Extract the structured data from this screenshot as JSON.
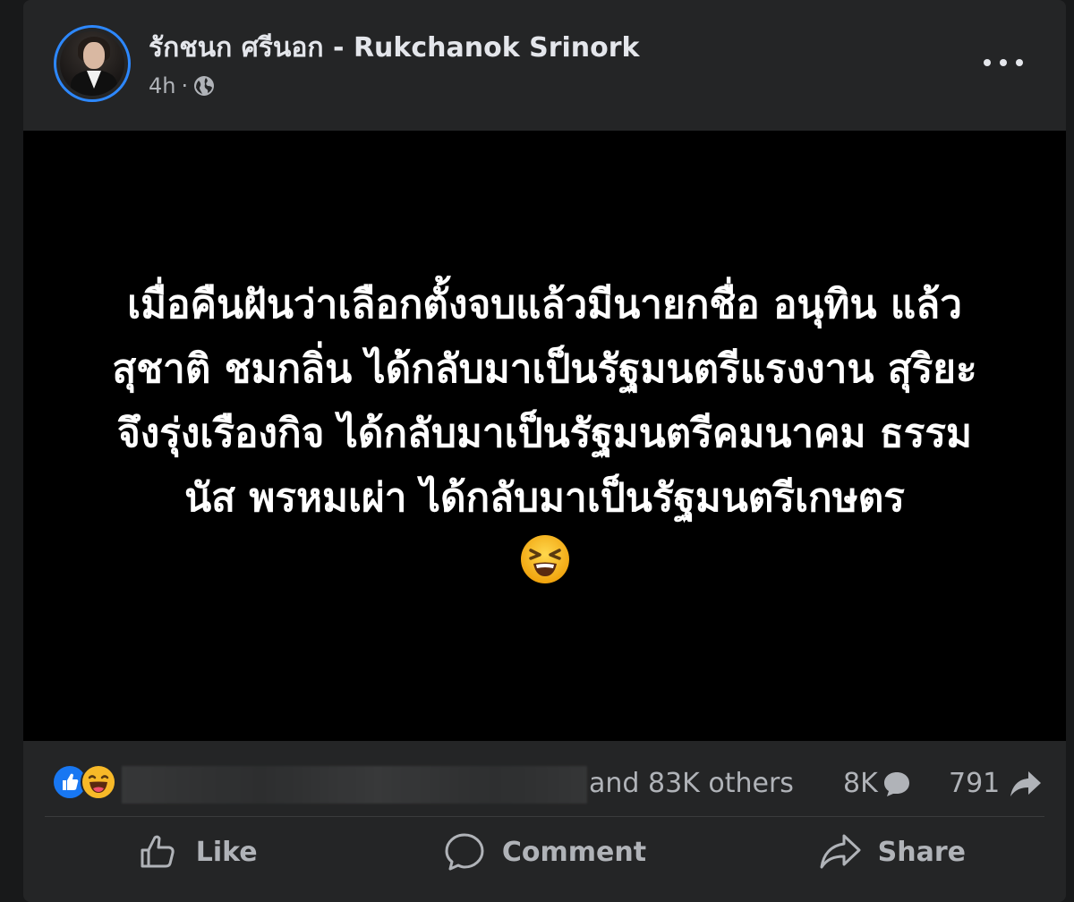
{
  "post": {
    "author": "รักชนก ศรีนอก - Rukchanok Srinork",
    "time": "4h",
    "separator": "·",
    "privacy_icon": "globe-icon",
    "menu_icon": "more-options-icon",
    "text": "เมื่อคืนฝันว่าเลือกตั้งจบแล้วมีนายกชื่อ อนุทิน แล้ว สุชาติ ชมกลิ่น ได้กลับมาเป็นรัฐมนตรีแรงงาน สุริยะ จึงรุ่งเรืองกิจ ได้กลับมาเป็นรัฐมนตรีคมนาคม ธรรมนัส พรหมเผ่า ได้กลับมาเป็นรัฐมนตรีเกษตร",
    "emoji_icon": "tired-face-emoji",
    "background_color": "#000000"
  },
  "stats": {
    "reactions": [
      "like-reaction-icon",
      "haha-reaction-icon"
    ],
    "others_text": "and 83K others",
    "comments": "8K",
    "shares": "791"
  },
  "actions": {
    "like": "Like",
    "comment": "Comment",
    "share": "Share"
  },
  "colors": {
    "page_bg": "#18191a",
    "card_bg": "#242526",
    "primary_text": "#e4e6eb",
    "secondary_text": "#b0b3b8",
    "accent": "#1877f2"
  }
}
